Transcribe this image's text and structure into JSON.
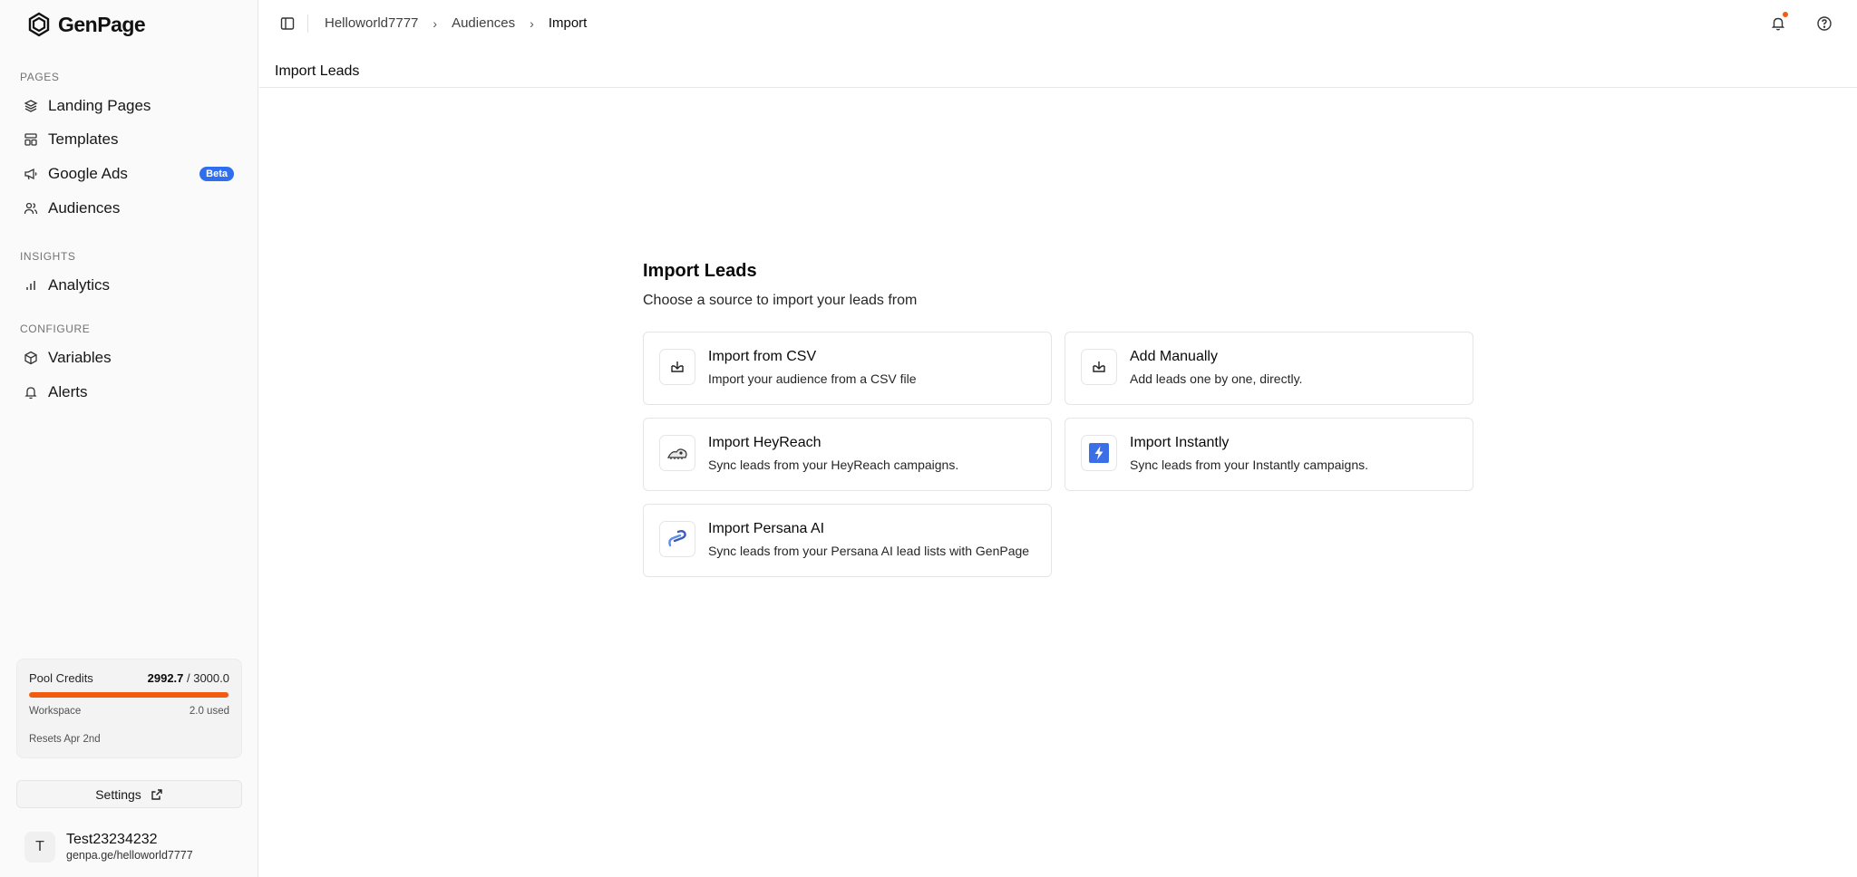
{
  "app": {
    "name": "GenPage",
    "accent": "#2f6fed",
    "credits_color": "#f25b10"
  },
  "sidebar": {
    "sections": [
      {
        "label": "PAGES",
        "items": [
          {
            "label": "Landing Pages",
            "icon": "layers-icon"
          },
          {
            "label": "Templates",
            "icon": "layout-icon"
          },
          {
            "label": "Google Ads",
            "icon": "megaphone-icon",
            "badge": "Beta"
          },
          {
            "label": "Audiences",
            "icon": "users-icon"
          }
        ]
      },
      {
        "label": "INSIGHTS",
        "items": [
          {
            "label": "Analytics",
            "icon": "bar-chart-icon"
          }
        ]
      },
      {
        "label": "CONFIGURE",
        "items": [
          {
            "label": "Variables",
            "icon": "cube-icon"
          },
          {
            "label": "Alerts",
            "icon": "bell-icon"
          }
        ]
      }
    ],
    "credits": {
      "label": "Pool Credits",
      "used": "2992.7",
      "total": " / 3000.0",
      "fraction": 0.9976,
      "workspace_label": "Workspace",
      "workspace_used": "2.0 used",
      "resets": "Resets Apr 2nd"
    },
    "settings_label": "Settings",
    "user": {
      "initial": "T",
      "name": "Test23234232",
      "url": "genpa.ge/helloworld7777"
    }
  },
  "header": {
    "breadcrumbs": [
      "Helloworld7777",
      "Audiences",
      "Import"
    ],
    "separator": "›"
  },
  "page": {
    "title": "Import Leads"
  },
  "main": {
    "heading": "Import Leads",
    "subheading": "Choose a source to import your leads from",
    "sources": [
      {
        "title": "Import from CSV",
        "desc": "Import your audience from a CSV file",
        "icon": "download-tray-icon"
      },
      {
        "title": "Add Manually",
        "desc": "Add leads one by one, directly.",
        "icon": "download-tray-icon"
      },
      {
        "title": "Import HeyReach",
        "desc": "Sync leads from your HeyReach campaigns.",
        "icon": "heyreach-logo-icon"
      },
      {
        "title": "Import Instantly",
        "desc": "Sync leads from your Instantly campaigns.",
        "icon": "instantly-logo-icon"
      },
      {
        "title": "Import Persana AI",
        "desc": "Sync leads from your Persana AI lead lists with GenPage",
        "icon": "persana-logo-icon"
      }
    ]
  }
}
